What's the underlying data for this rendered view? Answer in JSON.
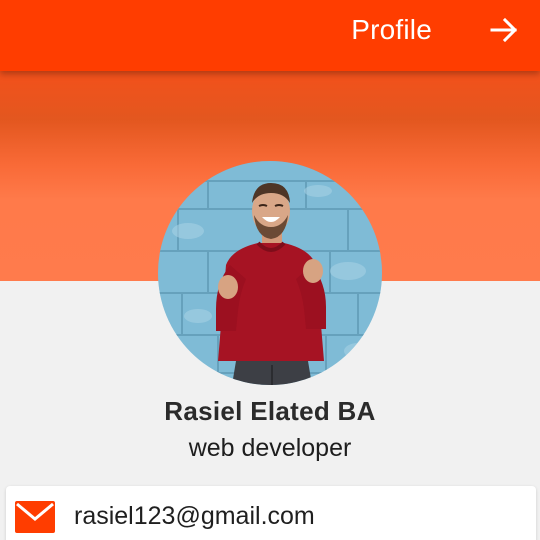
{
  "app_bar": {
    "title": "Profile",
    "action_icon": "arrow-right-icon"
  },
  "profile": {
    "avatar_icon": "profile-photo",
    "name": "Rasiel Elated BA",
    "role": "web developer"
  },
  "contacts": [
    {
      "icon": "mail-icon",
      "value": "rasiel123@gmail.com"
    }
  ],
  "colors": {
    "app_bar": "#ff3d00",
    "accent": "#ff3d00",
    "header_gradient_start": "#ff4a1a",
    "header_gradient_end": "#ff7b4c",
    "background": "#f1f1f1"
  }
}
